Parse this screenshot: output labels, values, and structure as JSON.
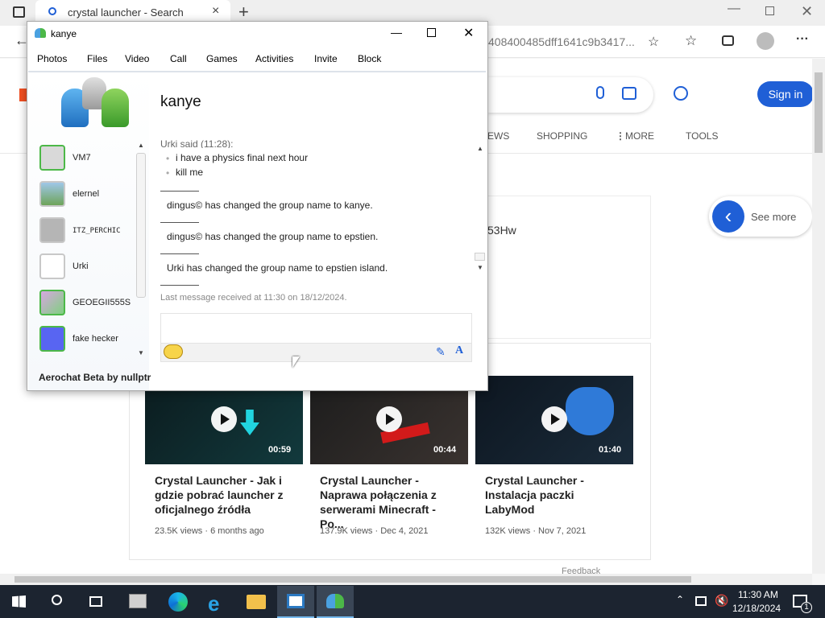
{
  "browser": {
    "tab_title": "crystal launcher - Search",
    "address_fragment": "408400485dff1641c9b3417...",
    "sign_in": "Sign in",
    "nav_tabs": [
      "EWS",
      "SHOPPING",
      "MORE",
      "TOOLS"
    ],
    "see_more": "See more",
    "partial_text": "53Hw",
    "feedback_fragment": "Feedback"
  },
  "videos": [
    {
      "title": "Crystal Launcher - Jak i gdzie pobrać launcher z oficjalnego źródła",
      "duration": "00:59",
      "views": "23.5K views",
      "age": "6 months ago"
    },
    {
      "title": "Crystal Launcher - Naprawa połączenia z serwerami Minecraft - Po...",
      "duration": "00:44",
      "views": "137.9K views",
      "age": "Dec 4, 2021"
    },
    {
      "title": "Crystal Launcher - Instalacja paczki LabyMod",
      "duration": "01:40",
      "views": "132K views",
      "age": "Nov 7, 2021"
    }
  ],
  "chat_window": {
    "title": "kanye",
    "menu": [
      "Photos",
      "Files",
      "Video",
      "Call",
      "Games",
      "Activities",
      "Invite",
      "Block"
    ],
    "conversation_name": "kanye",
    "contacts": [
      "VM7",
      "elernel",
      "ITZ_PERCHIC",
      "Urki",
      "GEOEGII555S",
      "fake hecker"
    ],
    "messages": {
      "header": "Urki said (11:28):",
      "lines": [
        "i have a physics final next hour",
        "kill me"
      ],
      "system": [
        "dingus© has changed the group name to kanye.",
        "dingus© has changed the group name to epstien.",
        "Urki has changed the group name to epstien island."
      ],
      "last_received": "Last message received at 11:30 on 18/12/2024."
    },
    "footer": "Aerochat Beta by nullptr"
  },
  "taskbar": {
    "time": "11:30 AM",
    "date": "12/18/2024",
    "notification_count": "1"
  },
  "colors": {
    "accent_blue": "#1f5fd6",
    "taskbar": "#1c2430"
  }
}
